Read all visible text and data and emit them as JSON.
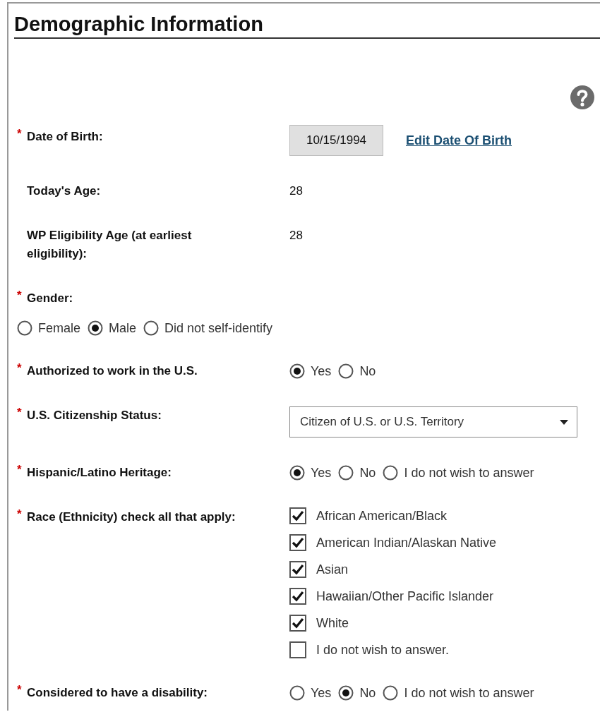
{
  "title": "Demographic Information",
  "fields": [
    {
      "kind": "date",
      "required_mark": "*",
      "label": "Date of Birth:",
      "value": "10/15/1994",
      "link": "Edit Date Of Birth"
    },
    {
      "kind": "text",
      "label": "Today's Age:",
      "value": "28"
    },
    {
      "kind": "text",
      "label": "WP Eligibility Age (at earliest eligibility):",
      "value": "28"
    },
    {
      "kind": "radio_below",
      "required_mark": "*",
      "label": "Gender:",
      "options": [
        {
          "label": "Female",
          "selected": false
        },
        {
          "label": "Male",
          "selected": true
        },
        {
          "label": "Did not self-identify",
          "selected": false
        }
      ]
    },
    {
      "kind": "radio",
      "required_mark": "*",
      "label": "Authorized to work in the U.S.",
      "options": [
        {
          "label": "Yes",
          "selected": true
        },
        {
          "label": "No",
          "selected": false
        }
      ]
    },
    {
      "kind": "select",
      "required_mark": "*",
      "label": "U.S. Citizenship Status:",
      "value": "Citizen of U.S. or U.S. Territory"
    },
    {
      "kind": "radio",
      "required_mark": "*",
      "label": "Hispanic/Latino Heritage:",
      "options": [
        {
          "label": "Yes",
          "selected": true
        },
        {
          "label": "No",
          "selected": false
        },
        {
          "label": "I do not wish to answer",
          "selected": false
        }
      ]
    },
    {
      "kind": "checkbox",
      "required_mark": "*",
      "label": "Race (Ethnicity) check all that apply:",
      "options": [
        {
          "label": "African American/Black",
          "checked": true
        },
        {
          "label": "American Indian/Alaskan Native",
          "checked": true
        },
        {
          "label": "Asian",
          "checked": true
        },
        {
          "label": "Hawaiian/Other Pacific Islander",
          "checked": true
        },
        {
          "label": "White",
          "checked": true
        },
        {
          "label": "I do not wish to answer.",
          "checked": false
        }
      ]
    },
    {
      "kind": "radio",
      "required_mark": "*",
      "label": "Considered to have a disability:",
      "options": [
        {
          "label": "Yes",
          "selected": false
        },
        {
          "label": "No",
          "selected": true
        },
        {
          "label": "I do not wish to answer",
          "selected": false
        }
      ]
    }
  ]
}
